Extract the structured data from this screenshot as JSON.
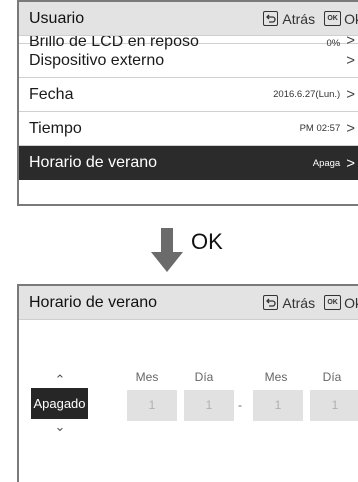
{
  "top_screen": {
    "header": {
      "title": "Usuario",
      "back_label": "Atrás",
      "ok_label": "Ok",
      "ok_icon_text": "OK"
    },
    "items": [
      {
        "label": "Brillo de LCD en reposo",
        "value": "0%"
      },
      {
        "label": "Dispositivo externo",
        "value": ""
      },
      {
        "label": "Fecha",
        "value": "2016.6.27(Lun.)"
      },
      {
        "label": "Tiempo",
        "value": "PM 02:57"
      },
      {
        "label": "Horario de verano",
        "value": "Apaga"
      }
    ]
  },
  "transition": {
    "label": "OK"
  },
  "bottom_screen": {
    "header": {
      "title": "Horario de verano",
      "back_label": "Atrás",
      "ok_label": "Ok",
      "ok_icon_text": "OK"
    },
    "toggle": {
      "value": "Apagado"
    },
    "start": {
      "month_label": "Mes",
      "month_value": "1",
      "day_label": "Día",
      "day_value": "1"
    },
    "separator": "-",
    "end": {
      "month_label": "Mes",
      "month_value": "1",
      "day_label": "Día",
      "day_value": "1"
    }
  }
}
